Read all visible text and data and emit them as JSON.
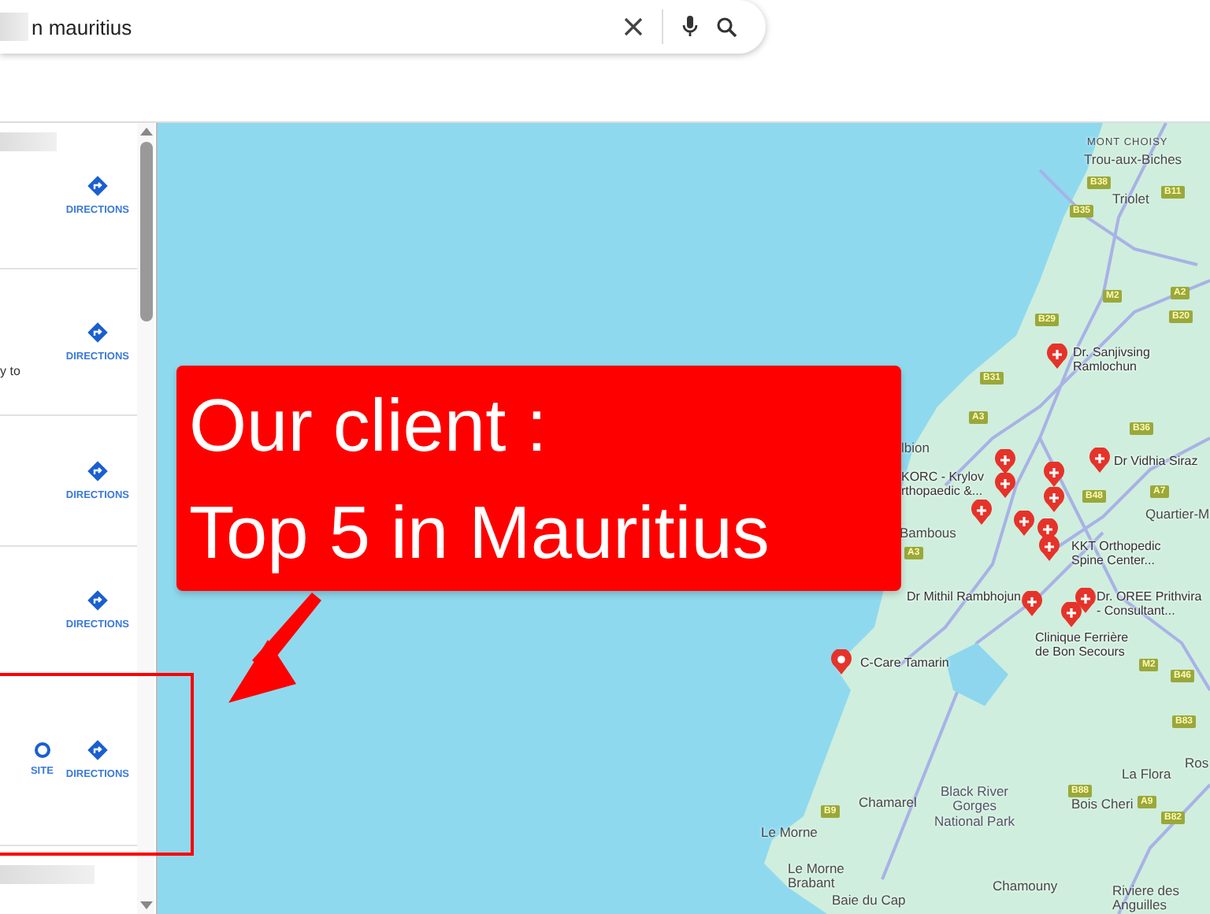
{
  "search": {
    "value": "n mauritius"
  },
  "results": [
    {
      "actions": [
        {
          "kind": "directions",
          "label": "DIRECTIONS"
        }
      ],
      "highlighted": false
    },
    {
      "snippet": "y to",
      "actions": [
        {
          "kind": "directions",
          "label": "DIRECTIONS"
        }
      ],
      "highlighted": false
    },
    {
      "actions": [
        {
          "kind": "directions",
          "label": "DIRECTIONS"
        }
      ],
      "highlighted": false
    },
    {
      "actions": [
        {
          "kind": "directions",
          "label": "DIRECTIONS"
        }
      ],
      "highlighted": false
    },
    {
      "actions": [
        {
          "kind": "website",
          "label": "SITE"
        },
        {
          "kind": "directions",
          "label": "DIRECTIONS"
        }
      ],
      "highlighted": true
    }
  ],
  "map": {
    "places": [
      {
        "kind": "district",
        "lines": [
          "MONT CHOISY"
        ]
      },
      {
        "kind": "town",
        "lines": [
          "Trou-aux-Biches"
        ]
      },
      {
        "kind": "town",
        "lines": [
          "Triolet"
        ]
      },
      {
        "kind": "town",
        "lines": [
          "lbion"
        ]
      },
      {
        "kind": "town",
        "lines": [
          "Bambous"
        ]
      },
      {
        "kind": "town",
        "lines": [
          "Quartier-M"
        ]
      },
      {
        "kind": "town",
        "lines": [
          "Chamarel"
        ]
      },
      {
        "kind": "park",
        "lines": [
          "Black River",
          "Gorges",
          "National Park"
        ]
      },
      {
        "kind": "town",
        "lines": [
          "Bois Cheri"
        ]
      },
      {
        "kind": "town",
        "lines": [
          "La Flora"
        ]
      },
      {
        "kind": "town",
        "lines": [
          "Ros"
        ]
      },
      {
        "kind": "town",
        "lines": [
          "Le Morne"
        ]
      },
      {
        "kind": "town",
        "lines": [
          "Le Morne",
          "Brabant"
        ]
      },
      {
        "kind": "town",
        "lines": [
          "Baie du Cap"
        ]
      },
      {
        "kind": "town",
        "lines": [
          "Chamouny"
        ]
      },
      {
        "kind": "town",
        "lines": [
          "Riviere des",
          "Anguilles"
        ]
      }
    ],
    "pins": [
      {
        "kind": "medical",
        "lines": [
          "Dr. Sanjivsing",
          "Ramlochun"
        ]
      },
      {
        "kind": "medical",
        "lines": [
          "KORC - Krylov",
          "rthopaedic &..."
        ]
      },
      {
        "kind": "medical",
        "lines": [
          "Dr Vidhia Siraz"
        ]
      },
      {
        "kind": "medical",
        "lines": [
          "KKT Orthopedic",
          "Spine Center..."
        ]
      },
      {
        "kind": "medical",
        "lines": [
          "Dr Mithil Rambhojun"
        ]
      },
      {
        "kind": "medical",
        "lines": [
          "Dr. OREE Prithvira",
          "- Consultant..."
        ]
      },
      {
        "kind": "medical",
        "lines": [
          "Clinique Ferrière",
          "de Bon Secours"
        ]
      },
      {
        "kind": "place",
        "lines": [
          "C-Care Tamarin"
        ]
      }
    ],
    "roads": [
      "B38",
      "B11",
      "B35",
      "M2",
      "A2",
      "B29",
      "B20",
      "B31",
      "A3",
      "B36",
      "B48",
      "A7",
      "A3",
      "M2",
      "B46",
      "B83",
      "B88",
      "A9",
      "B82",
      "B9"
    ]
  },
  "annotation": {
    "lines": [
      "Our client :",
      "Top 5 in Mauritius"
    ]
  }
}
